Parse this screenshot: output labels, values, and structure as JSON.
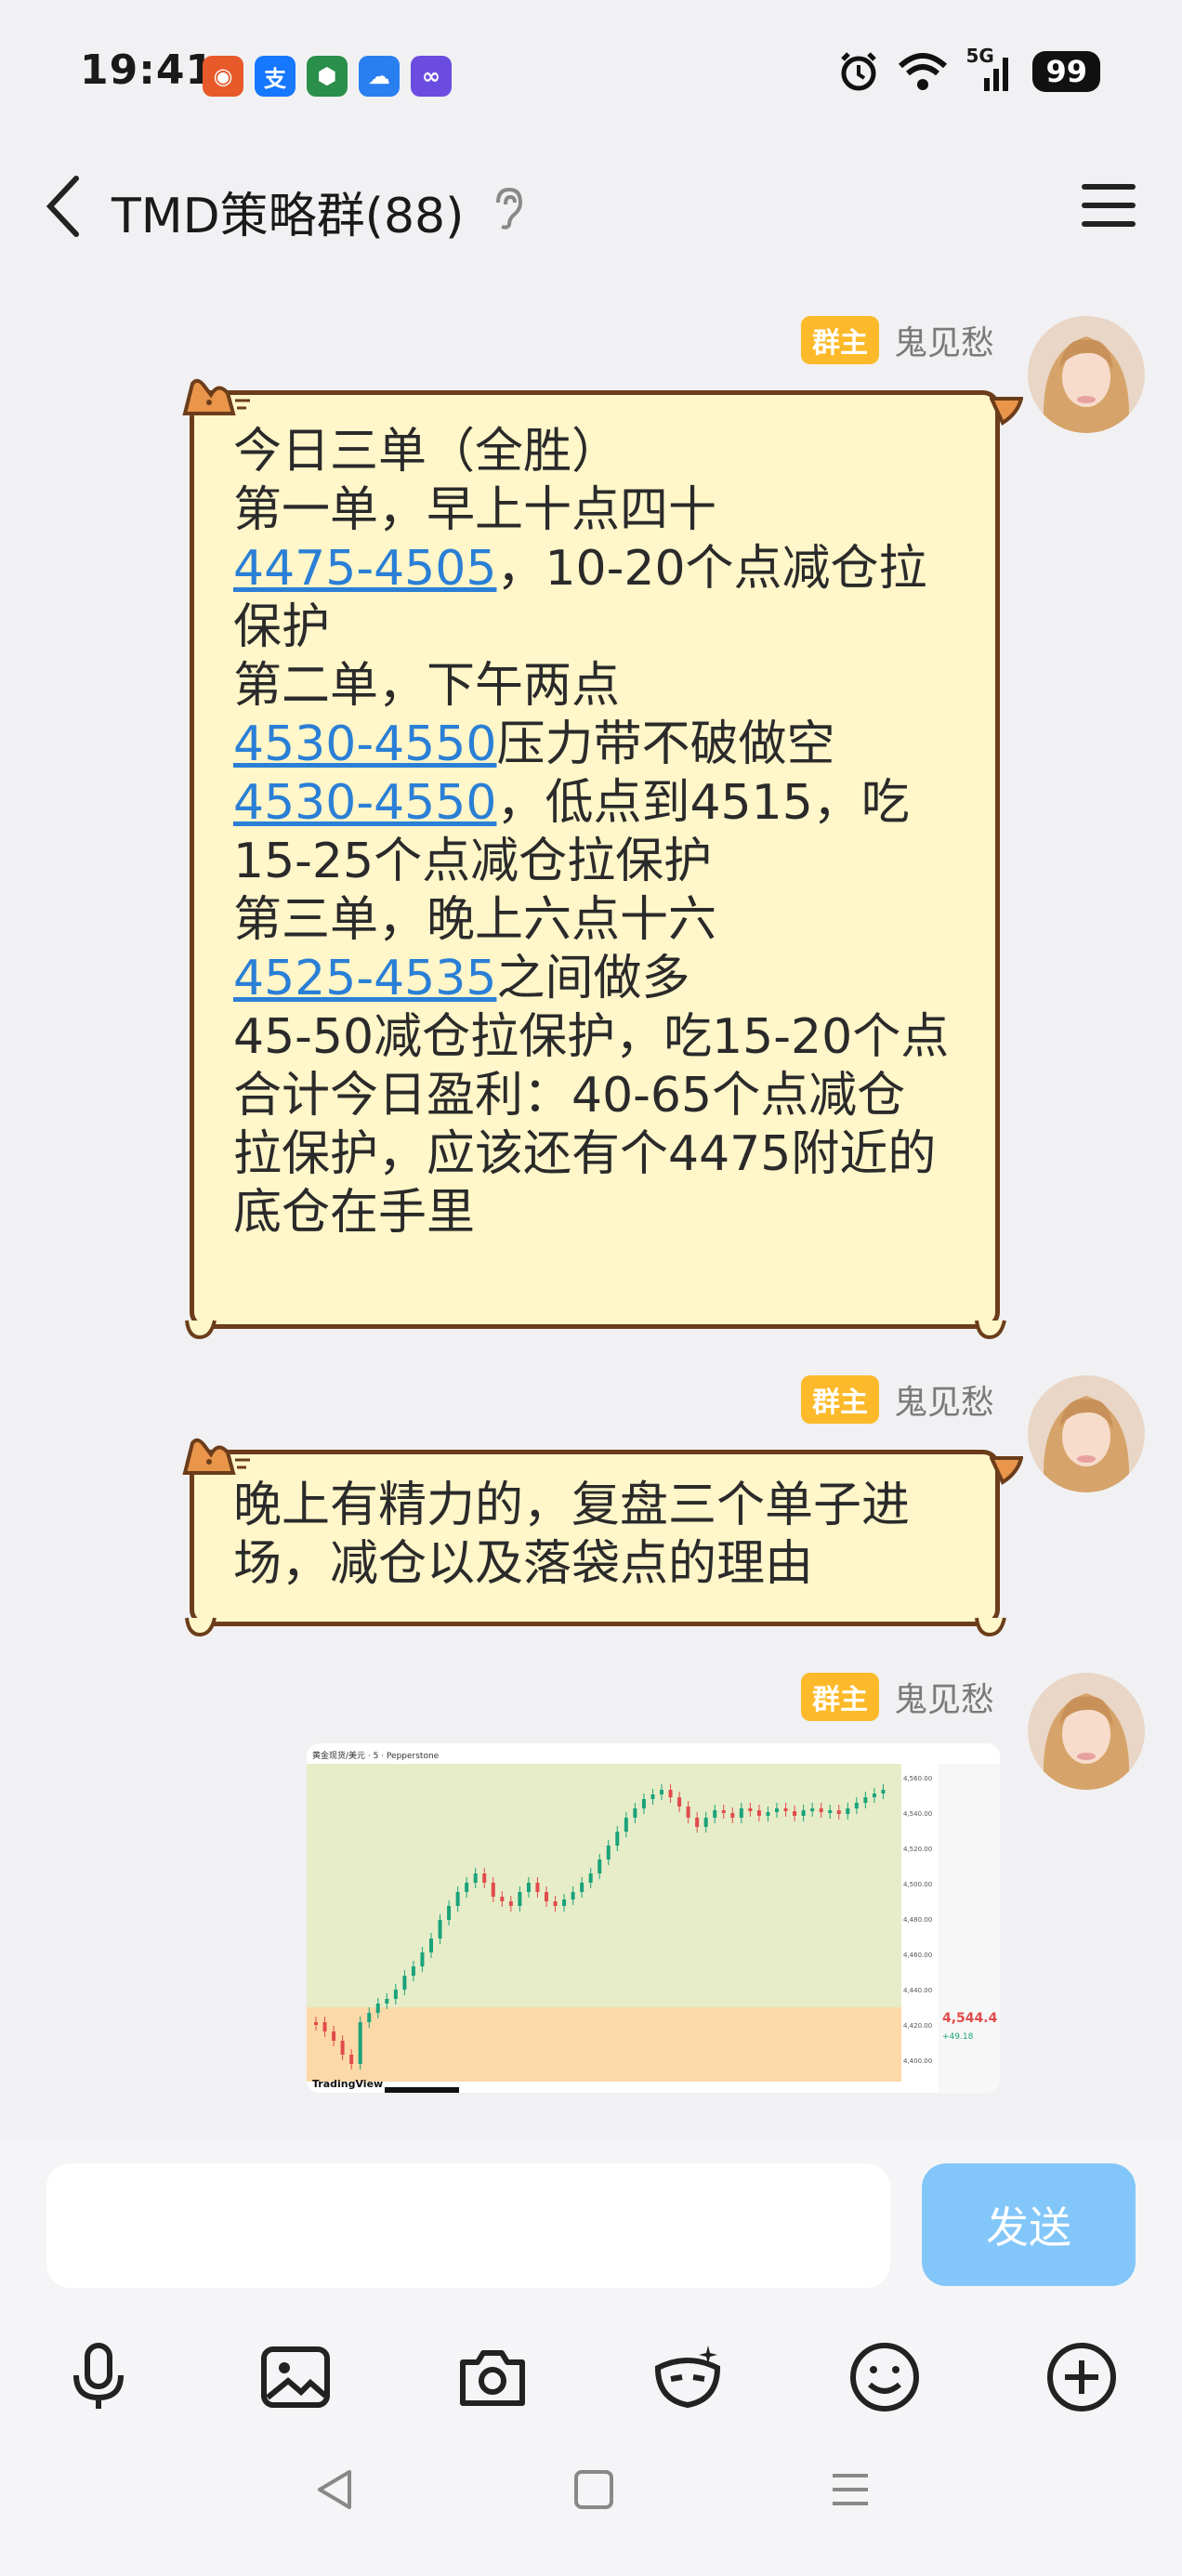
{
  "status_bar": {
    "time": "19:41",
    "network": "5G",
    "battery": "99",
    "app_icons": [
      "app-notification-icon",
      "alipay-icon",
      "app-cube-icon",
      "app-cloud-icon",
      "app-infinity-icon"
    ]
  },
  "header": {
    "title": "TMD策略群(88)",
    "back_icon": "chevron-left-icon",
    "ear_icon": "ear-icon",
    "menu_icon": "menu-icon"
  },
  "messages": [
    {
      "badge": "群主",
      "sender": "鬼见愁",
      "lines": [
        {
          "text": "今日三单（全胜）"
        },
        {
          "text": "第一单，早上十点四十"
        },
        {
          "link": "4475-4505",
          "text": "，10-20个点减仓拉"
        },
        {
          "text": "保护"
        },
        {
          "text": "第二单，下午两点"
        },
        {
          "link": "4530-4550",
          "text": "压力带不破做空"
        },
        {
          "link": "4530-4550",
          "text": "，低点到4515，吃"
        },
        {
          "text": "15-25个点减仓拉保护"
        },
        {
          "text": "第三单，晚上六点十六"
        },
        {
          "link": "4525-4535",
          "text": "之间做多"
        },
        {
          "text": "45-50减仓拉保护，吃15-20个点"
        },
        {
          "text": "合计今日盈利：40-65个点减仓"
        },
        {
          "text": "拉保护，应该还有个4475附近的"
        },
        {
          "text": "底仓在手里"
        }
      ]
    },
    {
      "badge": "群主",
      "sender": "鬼见愁",
      "lines": [
        {
          "text": "晚上有精力的，复盘三个单子进"
        },
        {
          "text": "场，减仓以及落袋点的理由"
        }
      ]
    },
    {
      "badge": "群主",
      "sender": "鬼见愁",
      "image": {
        "symbol": "黄金现货/美元 · 5 · Pepperstone",
        "brand": "TradingView",
        "price": "4,544.4",
        "change": "+49.18",
        "y_ticks": [
          "4,560.00",
          "4,540.00",
          "4,520.00",
          "4,500.00",
          "4,480.00",
          "4,460.00",
          "4,440.00",
          "4,420.00",
          "4,400.00"
        ],
        "accent_green": "#1aa37a",
        "accent_red": "#e24b4b",
        "bg_top": "#e6edc8",
        "bg_bottom": "#fbd9a8"
      }
    }
  ],
  "composer": {
    "input_placeholder": "",
    "send_label": "发送",
    "tools": [
      "microphone-icon",
      "image-icon",
      "camera-icon",
      "mask-icon",
      "emoji-icon",
      "plus-icon"
    ]
  },
  "nav": [
    "back-triangle-icon",
    "home-square-icon",
    "recents-menu-icon"
  ]
}
